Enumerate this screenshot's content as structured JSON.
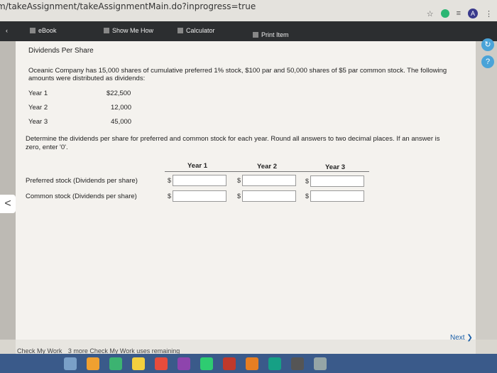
{
  "browser": {
    "url": "m/takeAssignment/takeAssignmentMain.do?inprogress=true"
  },
  "toolbar": {
    "ebook": "eBook",
    "show_me_how": "Show Me How",
    "calculator": "Calculator",
    "print_item": "Print Item"
  },
  "problem": {
    "title": "Dividends Per Share",
    "description_line1": "Oceanic Company has 15,000 shares of cumulative preferred 1% stock, $100 par and 50,000 shares of $5 par common stock. The following",
    "description_line2": "amounts were distributed as dividends:",
    "distributions": [
      {
        "label": "Year 1",
        "amount": "$22,500"
      },
      {
        "label": "Year 2",
        "amount": "12,000"
      },
      {
        "label": "Year 3",
        "amount": "45,000"
      }
    ],
    "instruction_line1": "Determine the dividends per share for preferred and common stock for each year. Round all answers to two decimal places. If an answer is",
    "instruction_line2": "zero, enter '0'."
  },
  "table": {
    "columns": [
      "Year 1",
      "Year 2",
      "Year 3"
    ],
    "currency_symbol": "$",
    "rows": [
      {
        "label": "Preferred stock (Dividends per share)"
      },
      {
        "label": "Common stock (Dividends per share)"
      }
    ]
  },
  "footer": {
    "check_work": "Check My Work",
    "remaining": "3 more Check My Work uses remaining",
    "next": "Next"
  },
  "rail": {
    "help": "?"
  },
  "colors": {
    "toolbar_bg": "#2c2e30",
    "accent": "#4aa3d8",
    "page_bg": "#f4f2ee"
  }
}
